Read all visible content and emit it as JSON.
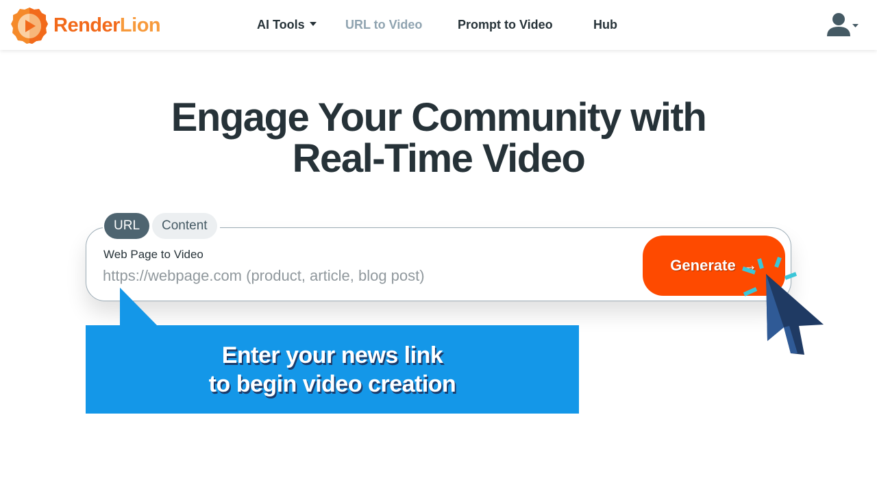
{
  "header": {
    "logo": {
      "part1": "Render",
      "part2": "Lion",
      "icon": "lion-play-logo-icon"
    },
    "nav": [
      {
        "label": "AI Tools",
        "has_dropdown": true,
        "state": "normal"
      },
      {
        "label": "URL to Video",
        "has_dropdown": false,
        "state": "muted"
      },
      {
        "label": "Prompt to Video",
        "has_dropdown": false,
        "state": "normal"
      },
      {
        "label": "Hub",
        "has_dropdown": false,
        "state": "normal"
      }
    ],
    "user_menu": {
      "icon": "user-icon",
      "dropdown_icon": "caret-down-icon"
    }
  },
  "hero": {
    "title_line1": "Engage Your Community with",
    "title_line2": "Real-Time Video"
  },
  "input_card": {
    "tabs": [
      {
        "label": "URL",
        "active": true
      },
      {
        "label": "Content",
        "active": false
      }
    ],
    "field_label": "Web Page to Video",
    "input_value": "",
    "input_placeholder": "https://webpage.com (product, article, blog post)",
    "generate_label": "Generate",
    "generate_arrow": "→"
  },
  "callout": {
    "line1": "Enter your news link",
    "line2": "to begin video creation"
  },
  "colors": {
    "brand_orange": "#f26a1b",
    "brand_orange_light": "#f79a3c",
    "generate_button": "#fe4a00",
    "callout_blue": "#1497e8",
    "text_dark": "#263238",
    "nav_muted": "#8fa3b0",
    "tab_active": "#4e6470",
    "cursor_dark": "#1f3a63",
    "cursor_light": "#2f5a96",
    "click_spark": "#3bc6d8"
  }
}
